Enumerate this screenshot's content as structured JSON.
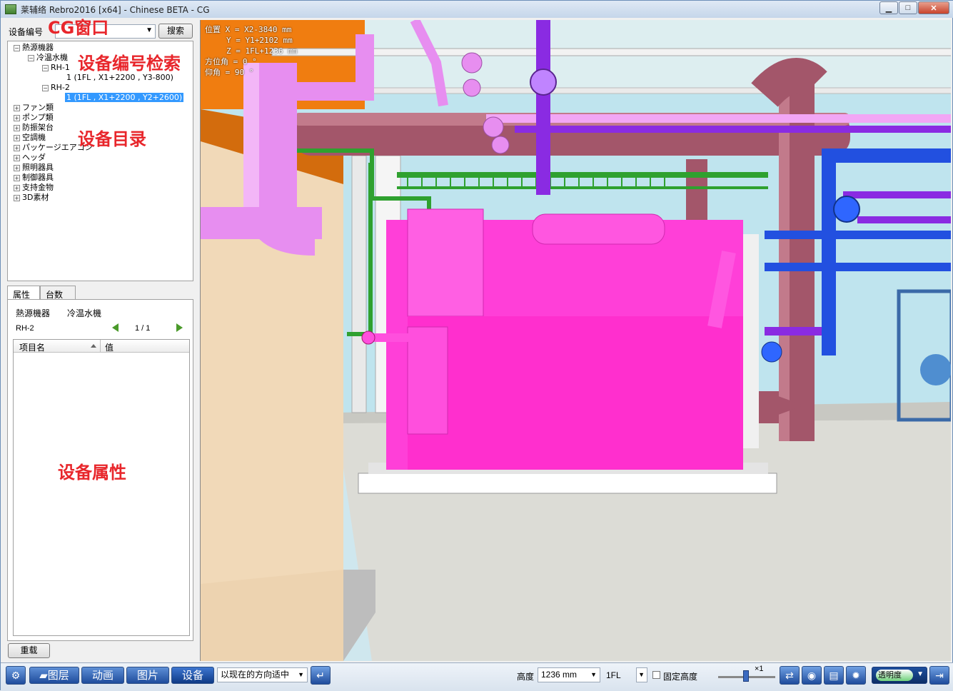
{
  "window": {
    "title": "莱辅络 Rebro2016 [x64] - Chinese BETA - CG",
    "min_label": "▁",
    "max_label": "□",
    "close_label": "✕"
  },
  "annotations": {
    "cg_window": "CG窗口",
    "search": "设备编号检索",
    "catalog": "设备目录",
    "properties": "设备属性"
  },
  "search": {
    "label": "设备编号",
    "button": "搜索"
  },
  "tree": {
    "root": "熱源機器",
    "child": "冷温水機",
    "rh1": "RH-1",
    "rh1_item": "1 (1FL , X1+2200 , Y3-800)",
    "rh2": "RH-2",
    "rh2_item": "1 (1FL , X1+2200 , Y2+2600)",
    "categories": [
      "ファン類",
      "ポンプ類",
      "防振架台",
      "空調機",
      "パッケージエアコン",
      "ヘッダ",
      "照明器具",
      "制御器具",
      "支持金物",
      "3D素材"
    ]
  },
  "tabs": [
    "属性",
    "台数"
  ],
  "properties": {
    "category": "熱源機器",
    "subcategory": "冷温水機",
    "id": "RH-2",
    "page": "1 / 1",
    "col_name": "项目名",
    "col_value": "值"
  },
  "reload_button": "重载",
  "viewport": {
    "pos_label": "位置",
    "x": "X = X2-3840 mm",
    "y": "Y = Y1+2102 mm",
    "z": "Z = 1FL+1236 mm",
    "azimuth": "方位角 = 0 °",
    "elevation": "仰角 = 90 °"
  },
  "toolbar": {
    "layers": "图层",
    "animation": "动画",
    "picture": "图片",
    "equipment": "设备",
    "direction_mode": "以现在的方向适中",
    "height_label": "高度",
    "height_value": "1236 mm",
    "floor": "1FL",
    "fix_height": "固定高度",
    "zoom": "×1",
    "transparency": "透明度"
  },
  "colors": {
    "equipment": "#ff3fd8",
    "pipe_pink": "#e78ef0",
    "pipe_maroon": "#a3566a",
    "pipe_blue": "#2250e0",
    "pipe_purple": "#8a2be2",
    "pipe_green": "#2fa12f",
    "accent": "#2b5aa8"
  }
}
